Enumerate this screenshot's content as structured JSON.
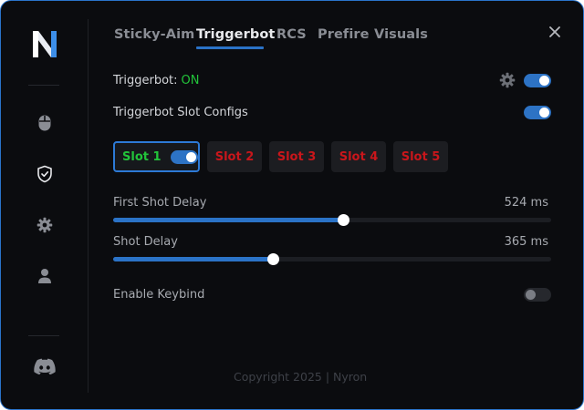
{
  "sidebar": {
    "logo_icon": "nyron-n-logo-icon",
    "items": [
      {
        "name": "mouse-icon"
      },
      {
        "name": "shield-icon",
        "active": true
      },
      {
        "name": "gear-icon"
      },
      {
        "name": "user-icon"
      }
    ],
    "discord_icon": "discord-icon"
  },
  "tabs": [
    {
      "label": "Sticky-Aim",
      "active": false
    },
    {
      "label": "Triggerbot",
      "active": true
    },
    {
      "label": "RCS",
      "active": false
    },
    {
      "label": "Prefire",
      "active": false
    },
    {
      "label": "Visuals",
      "active": false
    }
  ],
  "triggerbot": {
    "label": "Triggerbot:",
    "status": "ON",
    "enabled": true
  },
  "slot_configs": {
    "label": "Triggerbot Slot Configs",
    "enabled": true
  },
  "slots": [
    {
      "label": "Slot 1",
      "active": true,
      "enabled": true
    },
    {
      "label": "Slot 2",
      "active": false
    },
    {
      "label": "Slot 3",
      "active": false
    },
    {
      "label": "Slot 4",
      "active": false
    },
    {
      "label": "Slot 5",
      "active": false
    }
  ],
  "sliders": {
    "first_shot_delay": {
      "label": "First Shot Delay",
      "value_text": "524 ms",
      "fraction": 0.525
    },
    "shot_delay": {
      "label": "Shot Delay",
      "value_text": "365 ms",
      "fraction": 0.365
    }
  },
  "keybind": {
    "label": "Enable Keybind",
    "enabled": false
  },
  "footer": {
    "copyright": "Copyright 2025 | Nyron"
  },
  "colors": {
    "accent": "#2b73c7",
    "on_green": "#22c33a",
    "slot_red": "#c9161b",
    "background": "#0b0c0f"
  }
}
